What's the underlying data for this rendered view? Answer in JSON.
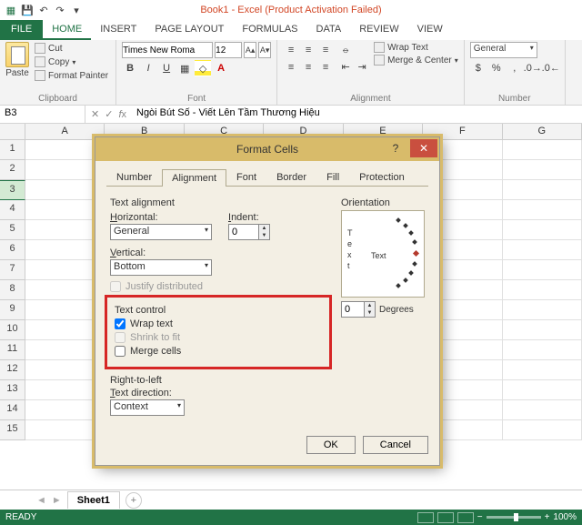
{
  "title": "Book1 - Excel (Product Activation Failed)",
  "tabs": {
    "file": "FILE",
    "home": "HOME",
    "insert": "INSERT",
    "pageLayout": "PAGE LAYOUT",
    "formulas": "FORMULAS",
    "data": "DATA",
    "review": "REVIEW",
    "view": "VIEW"
  },
  "clipboard": {
    "paste": "Paste",
    "cut": "Cut",
    "copy": "Copy",
    "painter": "Format Painter",
    "group": "Clipboard"
  },
  "font": {
    "name": "Times New Roma",
    "size": "12",
    "group": "Font"
  },
  "alignment": {
    "wrap": "Wrap Text",
    "merge": "Merge & Center",
    "group": "Alignment"
  },
  "number": {
    "format": "General",
    "group": "Number"
  },
  "namebox": "B3",
  "formula": "Ngòi Bút Số - Viết Lên Tầm Thương Hiệu",
  "cols": [
    "A",
    "B",
    "C",
    "D",
    "E",
    "F",
    "G"
  ],
  "rowcount": 15,
  "activeRow": 3,
  "sheet": {
    "tab1": "Sheet1"
  },
  "status": {
    "ready": "READY",
    "zoom": "100%"
  },
  "dialog": {
    "title": "Format Cells",
    "tabs": {
      "number": "Number",
      "alignment": "Alignment",
      "font": "Font",
      "border": "Border",
      "fill": "Fill",
      "protection": "Protection"
    },
    "textAlignment": "Text alignment",
    "horizontal": "Horizontal:",
    "horizontalVal": "General",
    "vertical": "Vertical:",
    "verticalVal": "Bottom",
    "indent": "Indent:",
    "indentVal": "0",
    "justify": "Justify distributed",
    "textControl": "Text control",
    "wrap": "Wrap text",
    "shrink": "Shrink to fit",
    "merge": "Merge cells",
    "rtl": "Right-to-left",
    "textDir": "Text direction:",
    "textDirVal": "Context",
    "orientation": "Orientation",
    "orientText": "Text",
    "deg": "0",
    "degrees": "Degrees",
    "ok": "OK",
    "cancel": "Cancel"
  }
}
